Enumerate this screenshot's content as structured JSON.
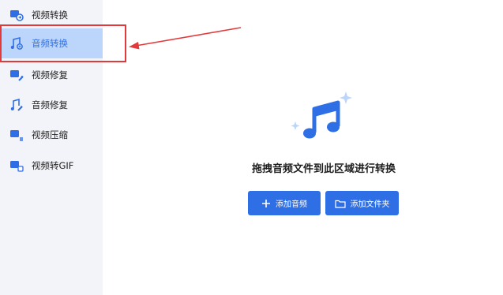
{
  "sidebar": {
    "items": [
      {
        "label": "视频转换",
        "icon": "video-convert-icon"
      },
      {
        "label": "音频转换",
        "icon": "music-note-icon",
        "active": true
      },
      {
        "label": "视频修复",
        "icon": "video-repair-icon"
      },
      {
        "label": "音频修复",
        "icon": "audio-repair-icon"
      },
      {
        "label": "视频压缩",
        "icon": "video-compress-icon"
      },
      {
        "label": "视频转GIF",
        "icon": "video-gif-icon"
      }
    ]
  },
  "main": {
    "drop_title": "拖拽音频文件到此区域进行转换",
    "add_audio_label": "添加音频",
    "add_folder_label": "添加文件夹"
  },
  "colors": {
    "accent": "#2f6fe6",
    "sidebar_bg": "#f3f4f9",
    "active_bg": "#bcd6fb",
    "annotation_red": "#e23a3a"
  }
}
